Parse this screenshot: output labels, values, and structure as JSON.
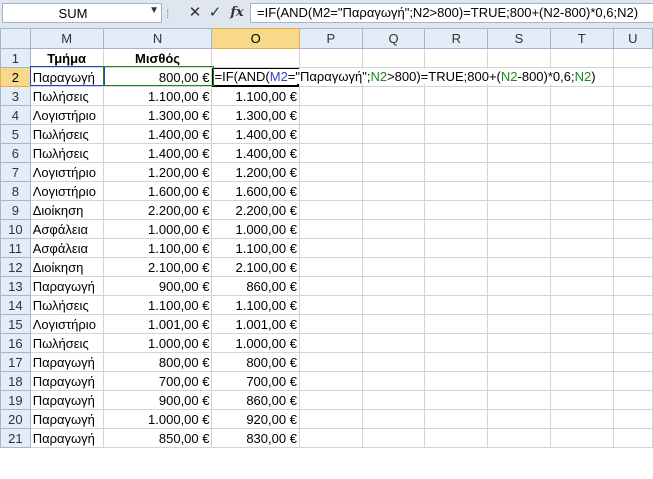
{
  "formula_bar": {
    "name_box": "SUM",
    "fx_label": "fx",
    "formula": "=IF(AND(M2=\"Παραγωγή\";N2>800)=TRUE;800+(N2-800)*0,6;N2)"
  },
  "columns": [
    "M",
    "N",
    "O",
    "P",
    "Q",
    "R",
    "S",
    "T",
    "U"
  ],
  "header_row": {
    "dept": "Τμήμα",
    "salary": "Μισθός"
  },
  "edit_cell": {
    "p1": "=IF(AND(",
    "ref_m": "M2",
    "p2": "=\"Παραγωγή\";",
    "ref_n1": "N2",
    "p3": ">800)=TRUE;800+(",
    "ref_n2": "N2",
    "p4": "-800)*0,6;",
    "ref_n3": "N2",
    "p5": ")"
  },
  "rows": [
    {
      "n": "2",
      "dept": "Παραγωγή",
      "salary": "800,00 €",
      "result": ""
    },
    {
      "n": "3",
      "dept": "Πωλήσεις",
      "salary": "1.100,00 €",
      "result": "1.100,00 €"
    },
    {
      "n": "4",
      "dept": "Λογιστήριο",
      "salary": "1.300,00 €",
      "result": "1.300,00 €"
    },
    {
      "n": "5",
      "dept": "Πωλήσεις",
      "salary": "1.400,00 €",
      "result": "1.400,00 €"
    },
    {
      "n": "6",
      "dept": "Πωλήσεις",
      "salary": "1.400,00 €",
      "result": "1.400,00 €"
    },
    {
      "n": "7",
      "dept": "Λογιστήριο",
      "salary": "1.200,00 €",
      "result": "1.200,00 €"
    },
    {
      "n": "8",
      "dept": "Λογιστήριο",
      "salary": "1.600,00 €",
      "result": "1.600,00 €"
    },
    {
      "n": "9",
      "dept": "Διοίκηση",
      "salary": "2.200,00 €",
      "result": "2.200,00 €"
    },
    {
      "n": "10",
      "dept": "Ασφάλεια",
      "salary": "1.000,00 €",
      "result": "1.000,00 €"
    },
    {
      "n": "11",
      "dept": "Ασφάλεια",
      "salary": "1.100,00 €",
      "result": "1.100,00 €"
    },
    {
      "n": "12",
      "dept": "Διοίκηση",
      "salary": "2.100,00 €",
      "result": "2.100,00 €"
    },
    {
      "n": "13",
      "dept": "Παραγωγή",
      "salary": "900,00 €",
      "result": "860,00 €"
    },
    {
      "n": "14",
      "dept": "Πωλήσεις",
      "salary": "1.100,00 €",
      "result": "1.100,00 €"
    },
    {
      "n": "15",
      "dept": "Λογιστήριο",
      "salary": "1.001,00 €",
      "result": "1.001,00 €"
    },
    {
      "n": "16",
      "dept": "Πωλήσεις",
      "salary": "1.000,00 €",
      "result": "1.000,00 €"
    },
    {
      "n": "17",
      "dept": "Παραγωγή",
      "salary": "800,00 €",
      "result": "800,00 €"
    },
    {
      "n": "18",
      "dept": "Παραγωγή",
      "salary": "700,00 €",
      "result": "700,00 €"
    },
    {
      "n": "19",
      "dept": "Παραγωγή",
      "salary": "900,00 €",
      "result": "860,00 €"
    },
    {
      "n": "20",
      "dept": "Παραγωγή",
      "salary": "1.000,00 €",
      "result": "920,00 €"
    },
    {
      "n": "21",
      "dept": "Παραγωγή",
      "salary": "850,00 €",
      "result": "830,00 €"
    }
  ],
  "header_row_number": "1"
}
